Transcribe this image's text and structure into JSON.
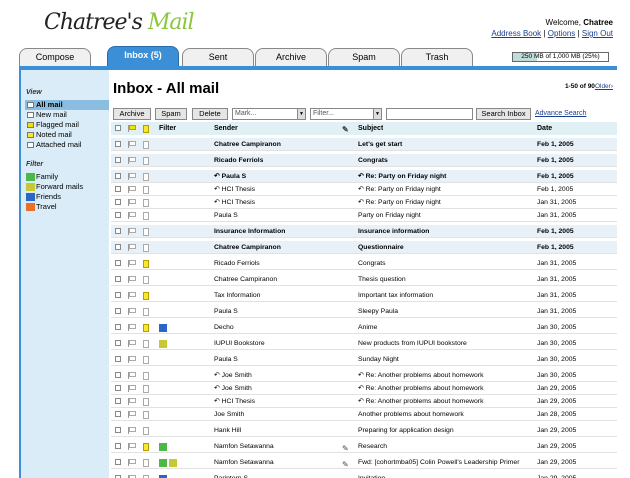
{
  "app": {
    "logo_text": "Chatree's",
    "logo_mail": "Mail",
    "welcome_prefix": "Welcome,",
    "user_name": "Chatree",
    "links": [
      "Address Book",
      "Options",
      "Sign Out"
    ],
    "link_separator": "|"
  },
  "tabs": [
    "Compose",
    "Inbox (5)",
    "Sent",
    "Archive",
    "Spam",
    "Trash"
  ],
  "quota": {
    "text": "250 MB of 1,000 MB (25%)",
    "fraction": 0.25
  },
  "sidebar": {
    "view_heading": "View",
    "view_items": [
      "All mail",
      "New mail",
      "Flagged mail",
      "Noted mail",
      "Attached mail"
    ],
    "filter_heading": "Filter",
    "filters": [
      {
        "label": "Family",
        "color": "#4db848"
      },
      {
        "label": "Forward mails",
        "color": "#c8c834"
      },
      {
        "label": "Friends",
        "color": "#2a66c8"
      },
      {
        "label": "Travel",
        "color": "#e8702a"
      }
    ]
  },
  "main": {
    "title": "Inbox - All mail",
    "pager_range": "1-50 of 90",
    "pager_next": "Older›",
    "buttons": {
      "archive": "Archive",
      "spam": "Spam",
      "delete": "Delete",
      "search": "Search Inbox"
    },
    "mark_select": "Mark...",
    "filter_select": "Filter...",
    "advanced_search": "Advance Search",
    "columns": {
      "filter": "Filter",
      "sender": "Sender",
      "subject": "Subject",
      "date": "Date"
    }
  },
  "colors": {
    "accent": "#3b8fd6",
    "sidebar_bg": "#d9ecf7",
    "unread_bg": "#e8f1f8"
  },
  "rows": [
    {
      "sender": "Chatree Campiranon",
      "subject": "Let's get start",
      "date": "Feb 1, 2005",
      "unread": true,
      "gap": true
    },
    {
      "sender": "Ricado Ferriols",
      "subject": "Congrats",
      "date": "Feb 1, 2005",
      "unread": true,
      "gap": true
    },
    {
      "sender": "Paula S",
      "subject": "Re: Party on Friday night",
      "date": "Feb 1, 2005",
      "unread": true,
      "gap": true,
      "thread": true
    },
    {
      "sender": "HCI Thesis",
      "subject": "Re: Party on Friday night",
      "date": "Feb 1, 2005",
      "thread": true
    },
    {
      "sender": "HCI Thesis",
      "subject": "Re: Party on Friday night",
      "date": "Jan 31, 2005",
      "thread": true
    },
    {
      "sender": "Paula S",
      "subject": "Party on Friday night",
      "date": "Jan 31, 2005"
    },
    {
      "sender": "Insurance Information",
      "subject": "Insurance information",
      "date": "Feb 1, 2005",
      "unread": true,
      "gap": true
    },
    {
      "sender": "Chatree Campiranon",
      "subject": "Questionnaire",
      "date": "Feb 1, 2005",
      "unread": true,
      "gap": true
    },
    {
      "sender": "Ricado Ferriols",
      "subject": "Congrats",
      "date": "Jan 31, 2005",
      "note": true,
      "gap": true
    },
    {
      "sender": "Chatree Campiranon",
      "subject": "Thesis question",
      "date": "Jan 31, 2005",
      "gap": true
    },
    {
      "sender": "Tax Information",
      "subject": "Important tax information",
      "date": "Jan 31, 2005",
      "note": true,
      "gap": true
    },
    {
      "sender": "Paula S",
      "subject": "Sleepy Paula",
      "date": "Jan 31, 2005",
      "gap": true
    },
    {
      "sender": "Decho",
      "subject": "Anime",
      "date": "Jan 30, 2005",
      "note": true,
      "cats": [
        "#2a66c8"
      ],
      "gap": true
    },
    {
      "sender": "IUPUI Bookstore",
      "subject": "New products from IUPUI bookstore",
      "date": "Jan 30, 2005",
      "cats": [
        "#c8c834"
      ],
      "gap": true
    },
    {
      "sender": "Paula S",
      "subject": "Sunday Night",
      "date": "Jan 30, 2005",
      "gap": true
    },
    {
      "sender": "Joe Smith",
      "subject": "Re: Another problems about homework",
      "date": "Jan 30, 2005",
      "thread": true,
      "gap": true
    },
    {
      "sender": "Joe Smith",
      "subject": "Re: Another problems about homework",
      "date": "Jan 29, 2005",
      "thread": true
    },
    {
      "sender": "HCI Thesis",
      "subject": "Re: Another problems about homework",
      "date": "Jan 29, 2005",
      "thread": true
    },
    {
      "sender": "Joe Smith",
      "subject": "Another problems about homework",
      "date": "Jan 28, 2005"
    },
    {
      "sender": "Hank Hill",
      "subject": "Preparing for application design",
      "date": "Jan 29, 2005",
      "gap": true
    },
    {
      "sender": "Namfon Setawanna",
      "subject": "Research",
      "date": "Jan 29, 2005",
      "note": true,
      "cats": [
        "#4db848"
      ],
      "attach": true,
      "gap": true
    },
    {
      "sender": "Namfon Setawanna",
      "subject": "Fwd: [cohortmba05] Colin Powell's Leadership Primer",
      "date": "Jan 29, 2005",
      "cats": [
        "#4db848",
        "#c8c834"
      ],
      "attach": true,
      "gap": true
    },
    {
      "sender": "Parintorn S",
      "subject": "Invitation",
      "date": "Jan 29, 2005",
      "cats": [
        "#2a66c8"
      ],
      "gap": true
    }
  ]
}
